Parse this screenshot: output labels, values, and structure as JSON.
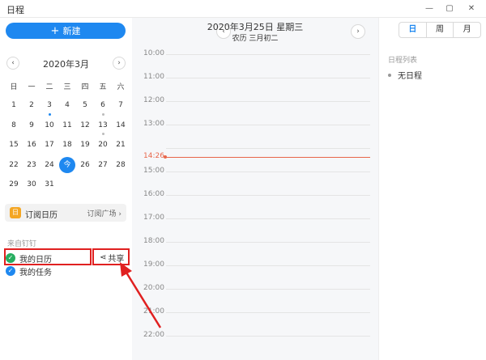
{
  "window": {
    "title": "日程",
    "minimize": "—",
    "maximize": "▢",
    "close": "✕"
  },
  "sidebar": {
    "new_button": "新建",
    "mini_calendar": {
      "month_title": "2020年3月",
      "prev": "‹",
      "next": "›",
      "weekdays": [
        "日",
        "一",
        "二",
        "三",
        "四",
        "五",
        "六"
      ],
      "weeks": [
        [
          "1",
          "2",
          "3",
          "4",
          "5",
          "6",
          "7"
        ],
        [
          "8",
          "9",
          "10",
          "11",
          "12",
          "13",
          "14"
        ],
        [
          "15",
          "16",
          "17",
          "18",
          "19",
          "20",
          "21"
        ],
        [
          "22",
          "23",
          "24",
          "今",
          "26",
          "27",
          "28"
        ],
        [
          "29",
          "30",
          "31",
          "",
          "",
          "",
          ""
        ]
      ]
    },
    "subscribe": {
      "icon": "日",
      "label": "订阅日历",
      "link": "订阅广场 ›"
    },
    "section_label": "来自钉钉",
    "calendars": [
      {
        "name": "我的日历",
        "color": "#27ae60",
        "check": "✓"
      },
      {
        "name": "我的任务",
        "color": "#1e88f0",
        "check": "✓"
      }
    ],
    "share_label": "共享",
    "share_icon": "⋖"
  },
  "main": {
    "date_title": "2020年3月25日 星期三",
    "lunar": "农历 三月初二",
    "prev": "‹",
    "next": "›",
    "hours": [
      "10:00",
      "11:00",
      "12:00",
      "13:00",
      "15:00",
      "16:00",
      "17:00",
      "18:00",
      "19:00",
      "20:00",
      "21:00",
      "22:00"
    ],
    "now_time": "14:26"
  },
  "right_panel": {
    "tabs": [
      "日",
      "周",
      "月"
    ],
    "active_tab": "日",
    "list_label": "日程列表",
    "no_schedule": "无日程"
  },
  "colors": {
    "accent": "#1e88f0",
    "now_line": "#e8664a",
    "highlight_box": "#e02020"
  }
}
